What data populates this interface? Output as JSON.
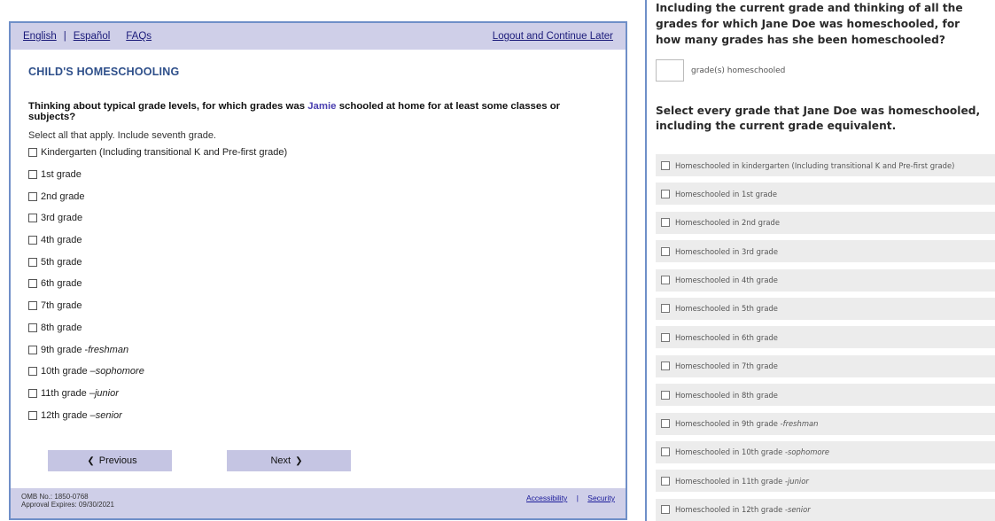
{
  "left": {
    "topbar": {
      "english": "English",
      "separator": "|",
      "espanol": "Español",
      "faqs": "FAQs",
      "logout": "Logout and Continue Later"
    },
    "section_title": "CHILD'S HOMESCHOOLING",
    "question": {
      "before": "Thinking about typical grade levels, for which grades was ",
      "name": "Jamie",
      "after": " schooled at home for at least some classes or subjects?"
    },
    "instruction": "Select all that apply. Include seventh grade.",
    "options": [
      {
        "label": "Kindergarten (Including transitional K and Pre-first grade)",
        "suffix": ""
      },
      {
        "label": "1st grade",
        "suffix": ""
      },
      {
        "label": "2nd grade",
        "suffix": ""
      },
      {
        "label": "3rd grade",
        "suffix": ""
      },
      {
        "label": "4th grade",
        "suffix": ""
      },
      {
        "label": "5th grade",
        "suffix": ""
      },
      {
        "label": "6th grade",
        "suffix": ""
      },
      {
        "label": "7th grade",
        "suffix": ""
      },
      {
        "label": "8th grade",
        "suffix": ""
      },
      {
        "label": "9th grade - ",
        "suffix": "freshman"
      },
      {
        "label": "10th grade – ",
        "suffix": "sophomore"
      },
      {
        "label": "11th grade – ",
        "suffix": "junior"
      },
      {
        "label": "12th grade – ",
        "suffix": "senior"
      }
    ],
    "buttons": {
      "previous": "Previous",
      "previous_arrow": "❮",
      "next": "Next",
      "next_arrow": "❯"
    },
    "footer": {
      "omb": "OMB No.: 1850-0768",
      "expires": "Approval Expires: 09/30/2021",
      "accessibility": "Accessibility",
      "separator": "|",
      "security": "Security"
    }
  },
  "right": {
    "question": "Including the current grade and thinking of all the grades for which Jane Doe was homeschooled, for how many grades has she been homeschooled?",
    "count_label": "grade(s) homeschooled",
    "count_value": "",
    "instruction": "Select every grade that Jane Doe was homeschooled, including the current grade equivalent.",
    "options": [
      {
        "label": "Homeschooled in kindergarten (Including transitional K and Pre-first grade)",
        "suffix": ""
      },
      {
        "label": "Homeschooled in 1st grade",
        "suffix": ""
      },
      {
        "label": "Homeschooled in 2nd grade",
        "suffix": ""
      },
      {
        "label": "Homeschooled in 3rd grade",
        "suffix": ""
      },
      {
        "label": "Homeschooled in 4th grade",
        "suffix": ""
      },
      {
        "label": "Homeschooled in 5th grade",
        "suffix": ""
      },
      {
        "label": "Homeschooled in 6th grade",
        "suffix": ""
      },
      {
        "label": "Homeschooled in 7th grade",
        "suffix": ""
      },
      {
        "label": "Homeschooled in 8th grade",
        "suffix": ""
      },
      {
        "label": "Homeschooled in 9th grade - ",
        "suffix": "freshman"
      },
      {
        "label": "Homeschooled in 10th grade - ",
        "suffix": "sophomore"
      },
      {
        "label": "Homeschooled in 11th grade - ",
        "suffix": "junior"
      },
      {
        "label": "Homeschooled in 12th grade - ",
        "suffix": "senior"
      }
    ]
  },
  "colors": {
    "panel_border": "#6f8fc8",
    "bar_background": "#cfcfe8",
    "title_blue": "#2e4f8a",
    "name_purple": "#4a3fb0",
    "button_background": "#c5c5e3",
    "option_background": "#ececec"
  },
  "icons": {
    "previous": "chevron-left-icon",
    "next": "chevron-right-icon",
    "checkbox": "checkbox-icon"
  }
}
